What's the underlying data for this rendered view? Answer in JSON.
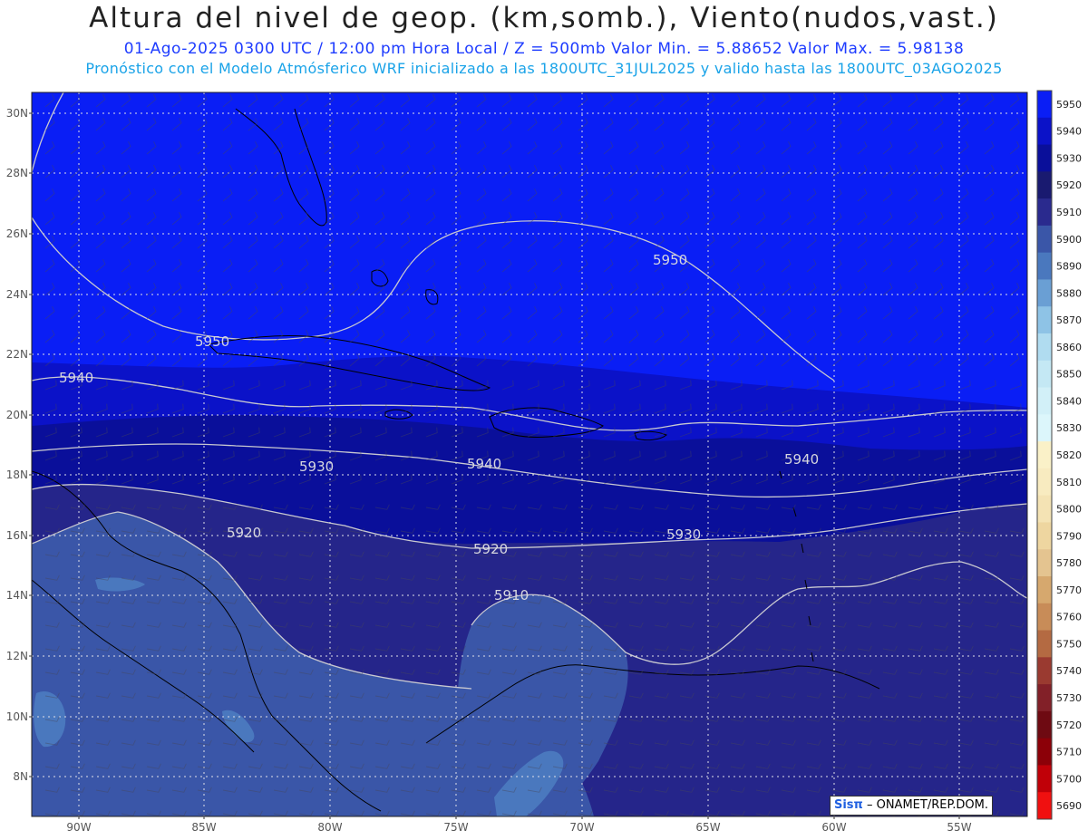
{
  "title": "Altura del nivel de geop. (km,somb.), Viento(nudos,vast.)",
  "subtitle": "01-Ago-2025  0300 UTC / 12:00 pm Hora Local / Z = 500mb   Valor Min. = 5.88652  Valor Max. = 5.98138",
  "subtitle2": "Pronóstico con el Modelo Atmósferico WRF inicializado a las 1800UTC_31JUL2025 y valido hasta las  1800UTC_03AGO2025",
  "credit": {
    "logo": "Sisπ",
    "text": "– ONAMET/REP.DOM."
  },
  "lat_labels": [
    "30N",
    "28N",
    "26N",
    "24N",
    "22N",
    "20N",
    "18N",
    "16N",
    "14N",
    "12N",
    "10N",
    "8N"
  ],
  "lon_labels": [
    "90W",
    "85W",
    "80W",
    "75W",
    "70W",
    "65W",
    "60W",
    "55W"
  ],
  "contour_labels": [
    "5950",
    "5950",
    "5940",
    "5940",
    "5940",
    "5930",
    "5930",
    "5920",
    "5920",
    "5910"
  ],
  "colorbar": {
    "levels": [
      "5950",
      "5940",
      "5930",
      "5920",
      "5910",
      "5900",
      "5890",
      "5880",
      "5870",
      "5860",
      "5850",
      "5840",
      "5830",
      "5820",
      "5810",
      "5800",
      "5790",
      "5780",
      "5770",
      "5760",
      "5750",
      "5740",
      "5730",
      "5720",
      "5710",
      "5700",
      "5690"
    ],
    "colors": [
      "#0a1ef5",
      "#0b12c8",
      "#0a0f9a",
      "#191a70",
      "#2a2a8e",
      "#3a56a8",
      "#4a78be",
      "#6a9fd4",
      "#8ec3e6",
      "#b0dcf0",
      "#c4e8f4",
      "#d2f0f8",
      "#dcf6fb",
      "#faf1c8",
      "#f8ebc0",
      "#f4e3b4",
      "#eed6a0",
      "#e4c490",
      "#d6a86e",
      "#c88c58",
      "#b46a42",
      "#9a3a30",
      "#822028",
      "#6e0a12",
      "#8c0008",
      "#c00008",
      "#f01010"
    ]
  },
  "fields": {
    "max_color": "#0a1ef5",
    "c5940_color": "#0b12c8",
    "c5930_color": "#0a0f9a",
    "c5920_color": "#25258a",
    "c5910_color": "#3a56a8",
    "c5900_color": "#4a78be",
    "contour_line_color": "#c8c8d0",
    "coast_color": "#000000"
  }
}
